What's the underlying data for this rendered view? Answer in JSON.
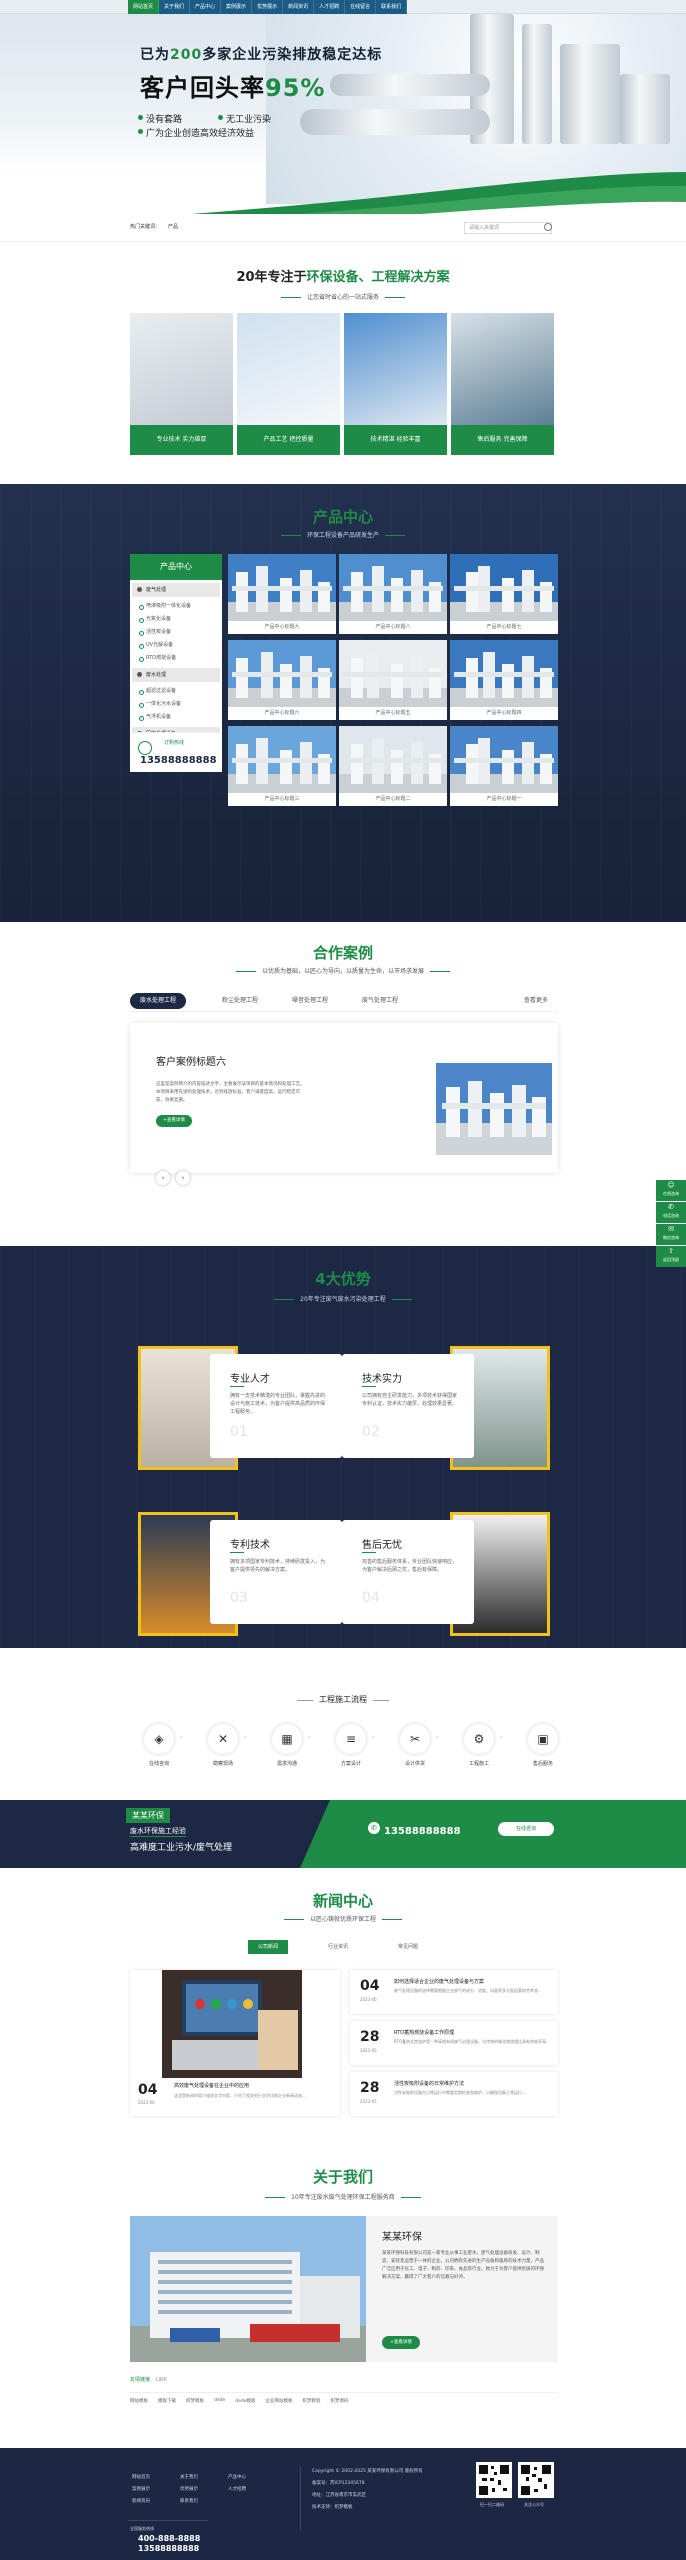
{
  "nav": [
    "网站首页",
    "关于我们",
    "产品中心",
    "案例展示",
    "优势展示",
    "新闻资讯",
    "人才招聘",
    "在线留言",
    "联系我们"
  ],
  "hero": {
    "line1_pre": "已为",
    "line1_num": "200",
    "line1_post": "多家企业污染排放稳定达标",
    "line2_pre": "客户回头率",
    "line2_num": "95%",
    "bullets": [
      "没有套路",
      "无工业污染",
      "广为企业创造高效经济效益"
    ]
  },
  "search": {
    "hot": "热门关键词：",
    "hot_word": "产品",
    "placeholder": "请输入关键词"
  },
  "intro": {
    "title_pre": "20年专注于",
    "title_hl": "环保设备、工程解决方案",
    "sub": "让您省时省心的一站式服务",
    "cards": [
      "专业技术 实力雄厚",
      "产品工艺 把控质量",
      "技术精湛 经验丰富",
      "售后服务 完善保障"
    ]
  },
  "products": {
    "title": "产品中心",
    "sub": "环保工程设备产品研发生产",
    "side_title": "产品中心",
    "cats": [
      {
        "name": "废气处理",
        "subs": [
          "喷淋吸附一体化设备",
          "光氧化设备",
          "活性炭设备",
          "UV光解设备",
          "RTO燃烧设备"
        ]
      },
      {
        "name": "废水处理",
        "subs": [
          "超滤过滤设备",
          "一体化污水设备",
          "气浮机设备"
        ]
      },
      {
        "name": "固废处理设备",
        "subs": [
          "固废处理设备"
        ]
      }
    ],
    "hotline_label": "订购热线",
    "hotline": "13588888888",
    "items": [
      "产品中心标题九",
      "产品中心标题八",
      "产品中心标题七",
      "产品中心标题六",
      "产品中心标题五",
      "产品中心标题四",
      "产品中心标题三",
      "产品中心标题二",
      "产品中心标题一"
    ]
  },
  "cases": {
    "title": "合作案例",
    "sub": "以优质为基础，以匠心为导向，以质量为生命，以市场求发展",
    "tabs": [
      "废水处理工程",
      "粉尘处理工程",
      "噪音处理工程",
      "废气处理工程"
    ],
    "more": "查看更多",
    "case_title": "客户案例标题六",
    "case_desc": "这里是案例简介的内容描述文字，主要展示该项目的基本情况和处理工艺。本项目采用先进的处理技术，达到排放标准，客户满意度高，运行稳定可靠，效果显著。",
    "case_btn": "+查看详情"
  },
  "advantages": {
    "title": "4大优势",
    "sub": "20年专注废气废水污染处理工程",
    "items": [
      {
        "title": "专业人才",
        "num": "01",
        "desc": "拥有一支技术精湛的专业团队，掌握先进的设计与施工技术，为客户提供高品质的环保工程服务。"
      },
      {
        "title": "技术实力",
        "num": "02",
        "desc": "公司拥有自主研发能力，多项技术获得国家专利认证，技术实力雄厚，处理效果显著。"
      },
      {
        "title": "专利技术",
        "num": "03",
        "desc": "拥有多项国家专利技术，持续研发投入，为客户提供领先的解决方案。"
      },
      {
        "title": "售后无忧",
        "num": "04",
        "desc": "完善的售后服务体系，专业团队快速响应，为客户解决后顾之忧，售后有保障。"
      }
    ]
  },
  "process": {
    "title": "工程施工流程",
    "steps": [
      "在线咨询",
      "勘察现场",
      "需求沟通",
      "方案设计",
      "设计供货",
      "工程施工",
      "售后服务"
    ]
  },
  "banner": {
    "brand": "某某环保",
    "t1": "废水环保施工经验",
    "t2": "高难度工业污水/废气处理",
    "phone": "13588888888",
    "btn": "在线咨询"
  },
  "news": {
    "title": "新闻中心",
    "sub": "以匠心铸就优质环保工程",
    "tabs": [
      "公司新闻",
      "行业资讯",
      "常见问题"
    ],
    "featured": {
      "day": "04",
      "ym": "2023-06",
      "title": "高效废气处理设备在企业中的应用",
      "desc": "这里是新闻的简介描述文字内容，介绍了相关的行业资讯和企业新闻动态..."
    },
    "items": [
      {
        "day": "04",
        "ym": "2023-06",
        "title": "如何选择适合企业的废气处理设备与方案",
        "desc": "废气处理设备的选择需要根据企业废气的成分、浓度、风量等多方面因素综合考虑..."
      },
      {
        "day": "28",
        "ym": "2023-05",
        "title": "RTO蓄热燃烧设备工作原理",
        "desc": "RTO蓄热式焚烧炉是一种高效有机废气治理设备，与传统的催化燃烧相比具有热效率高..."
      },
      {
        "day": "28",
        "ym": "2023-05",
        "title": "活性炭吸附设备的日常维护方法",
        "desc": "活性炭吸附设备在日常运行中需要定期检查和维护，以确保设备正常运行..."
      }
    ]
  },
  "about": {
    "title": "关于我们",
    "sub": "10年专注废水废气处理环保工程服务商",
    "name": "某某环保",
    "desc": "某某环保科技有限公司是一家专业从事工业废水、废气处理设备研发、设计、制造、安装及运营于一体的企业。公司拥有先进的生产设备和雄厚的技术力量，产品广泛应用于化工、电子、制药、印染、食品等行业，致力于为客户提供优质的环保解决方案，赢得了广大客户的信赖与好评。",
    "btn": "+查看详情"
  },
  "links": {
    "label": "友情链接",
    "label2": "LINK",
    "items": [
      "网站模板",
      "模板下载",
      "织梦模板",
      "dede",
      "dede模板",
      "企业网站模板",
      "织梦教程",
      "织梦源码"
    ]
  },
  "footer": {
    "cols": [
      [
        "网站首页",
        "案例展示",
        "新闻资讯"
      ],
      [
        "关于我们",
        "优势展示",
        "联系我们"
      ],
      [
        "产品中心",
        "人才招聘"
      ]
    ],
    "tel_label": "全国服务热线",
    "tel1": "400-888-8888",
    "tel2": "13588888888",
    "copyright": "Copyright © 2002-2025 某某环保有限公司 版权所有",
    "icp": "备案号：苏ICP12345678",
    "addr": "地址：江苏省南京市玄武区",
    "extra": "技术支持：织梦模板",
    "qr1": "扫一扫二维码",
    "qr2": "关注公众号"
  },
  "float": [
    "在线咨询",
    "电话咨询",
    "微信咨询",
    "返回顶部"
  ]
}
